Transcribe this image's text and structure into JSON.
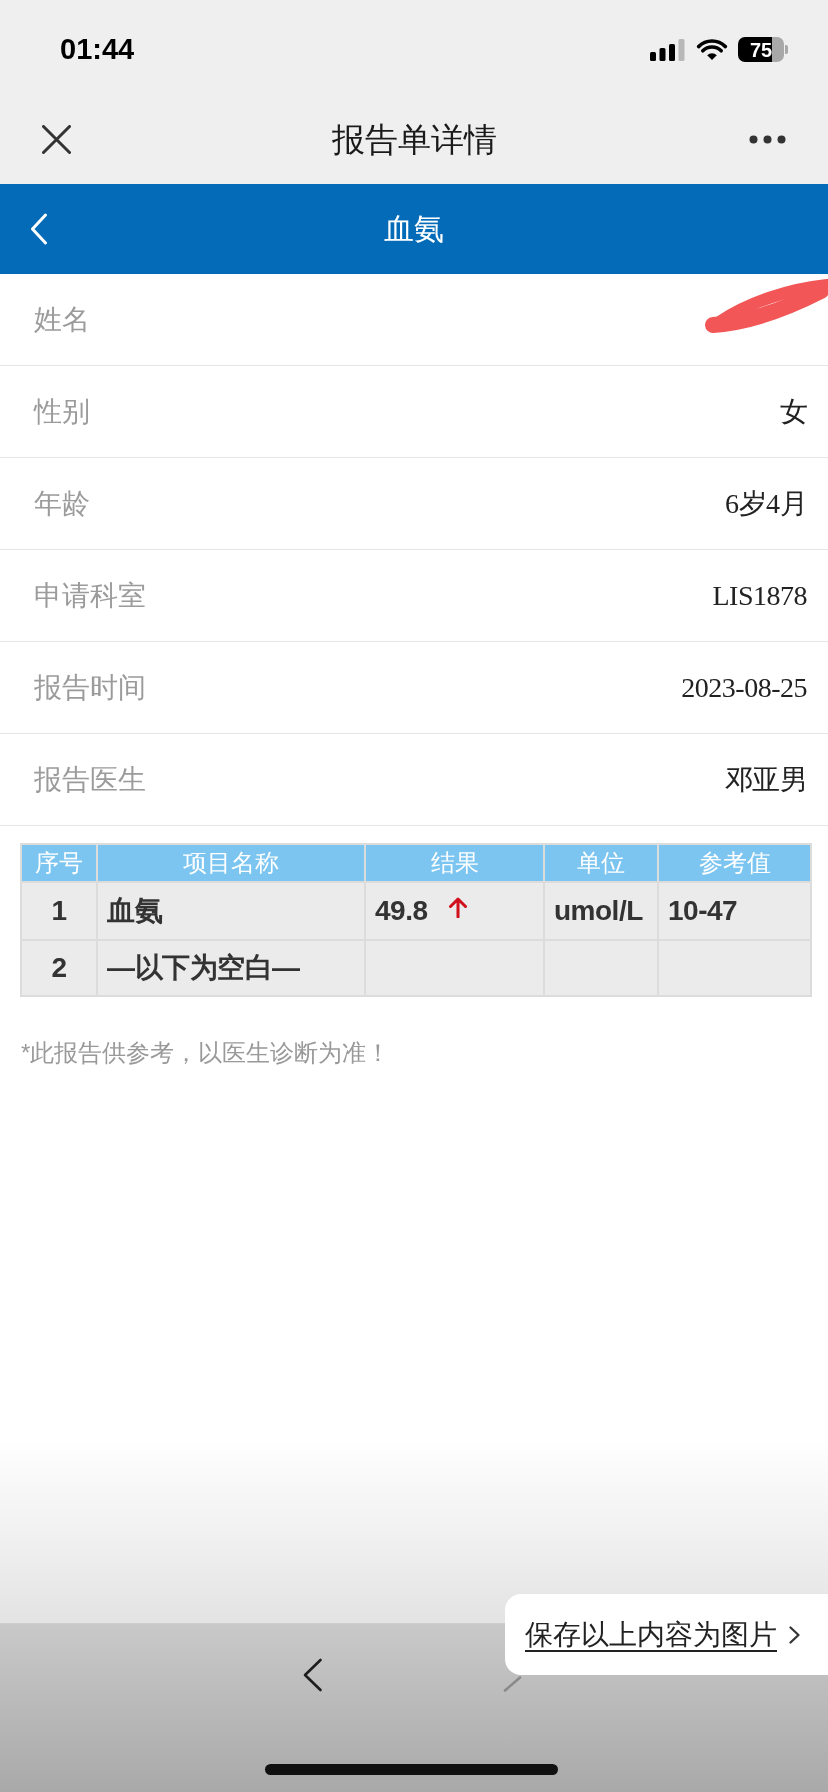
{
  "status_bar": {
    "time": "01:44",
    "battery": "75"
  },
  "nav_bar": {
    "title": "报告单详情"
  },
  "header": {
    "title": "血氨"
  },
  "info_rows": [
    {
      "label": "姓名",
      "redacted": true
    },
    {
      "label": "性别",
      "value": "女",
      "redacted": false
    },
    {
      "label": "年龄",
      "value": "6岁4月",
      "redacted": false
    },
    {
      "label": "申请科室",
      "value": "LIS1878",
      "redacted": false
    },
    {
      "label": "报告时间",
      "value": "2023-08-25",
      "redacted": false
    },
    {
      "label": "报告医生",
      "value": "邓亚男",
      "redacted": false
    }
  ],
  "results_table": {
    "columns": [
      "序号",
      "项目名称",
      "结果",
      "单位",
      "参考值"
    ],
    "rows": [
      {
        "no": "1",
        "item": "血氨",
        "result": "49.8",
        "above_range": true,
        "unit": "umol/L",
        "reference": "10-47"
      },
      {
        "no": "2",
        "item": "—以下为空白—",
        "above_range": false
      }
    ]
  },
  "footnote": "*此报告供参考，以医生诊断为准！",
  "toolbar": {
    "back_disabled": false,
    "forward_disabled": true
  },
  "save_popup": {
    "label": "保存以上内容为图片"
  }
}
